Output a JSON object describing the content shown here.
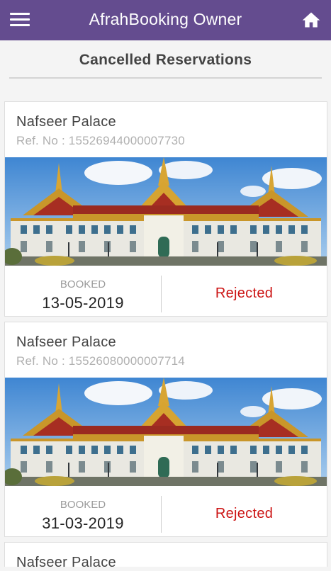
{
  "app_bar": {
    "title": "AfrahBooking Owner",
    "menu_icon": "menu-icon",
    "home_icon": "home-icon"
  },
  "page": {
    "title": "Cancelled Reservations"
  },
  "reservations": [
    {
      "venue": "Nafseer Palace",
      "ref_label": "Ref. No : 15526944000007730",
      "booked_label": "BOOKED",
      "booked_date": "13-05-2019",
      "status": "Rejected"
    },
    {
      "venue": "Nafseer Palace",
      "ref_label": "Ref. No : 15526080000007714",
      "booked_label": "BOOKED",
      "booked_date": "31-03-2019",
      "status": "Rejected"
    },
    {
      "venue": "Nafseer Palace"
    }
  ],
  "colors": {
    "app_bar": "#644c8f",
    "rejected": "#cc1414"
  }
}
